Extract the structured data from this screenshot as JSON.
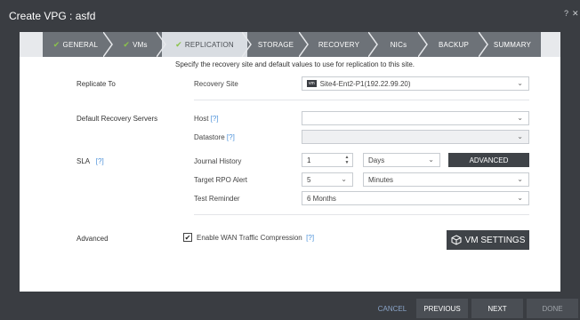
{
  "window": {
    "title": "Create VPG : asfd",
    "help_glyph": "?",
    "close_glyph": "✕"
  },
  "wizard": {
    "check_glyph": "✔",
    "steps": [
      {
        "label": "GENERAL",
        "state": "done"
      },
      {
        "label": "VMs",
        "state": "done"
      },
      {
        "label": "REPLICATION",
        "state": "active"
      },
      {
        "label": "STORAGE",
        "state": "pending"
      },
      {
        "label": "RECOVERY",
        "state": "pending"
      },
      {
        "label": "NICs",
        "state": "pending"
      },
      {
        "label": "BACKUP",
        "state": "pending"
      },
      {
        "label": "SUMMARY",
        "state": "pending"
      }
    ]
  },
  "intro": "Specify the recovery site and default values to use for replication to this site.",
  "replicate_to": {
    "section_label": "Replicate To",
    "field_label": "Recovery Site",
    "badge": "vm",
    "value": "Site4-Ent2-P1(192.22.99.20)"
  },
  "recovery_servers": {
    "section_label": "Default Recovery Servers",
    "host_label": "Host",
    "host_help": "[?]",
    "host_value": "",
    "datastore_label": "Datastore",
    "datastore_help": "[?]",
    "datastore_value": ""
  },
  "sla": {
    "section_label": "SLA",
    "help": "[?]",
    "journal_label": "Journal History",
    "journal_value": "1",
    "journal_unit": "Days",
    "advanced_button": "ADVANCED",
    "rpo_label": "Target RPO Alert",
    "rpo_value": "5",
    "rpo_unit": "Minutes",
    "test_label": "Test Reminder",
    "test_value": "6 Months"
  },
  "advanced": {
    "section_label": "Advanced",
    "wan_label": "Enable WAN Traffic Compression",
    "wan_help": "[?]",
    "wan_checked": true,
    "vm_settings_button": "VM SETTINGS"
  },
  "footer": {
    "cancel": "CANCEL",
    "previous": "PREVIOUS",
    "next": "NEXT",
    "done": "DONE"
  }
}
